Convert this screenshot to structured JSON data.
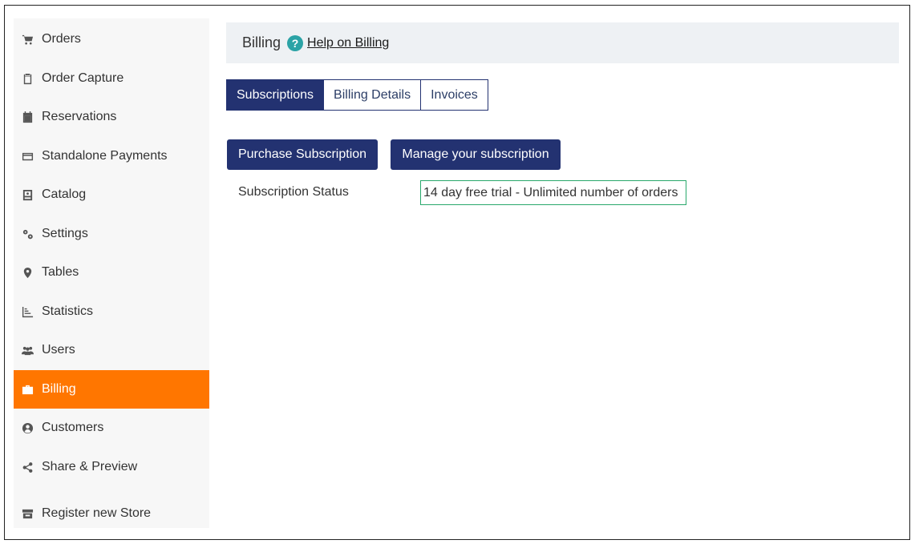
{
  "sidebar": {
    "items": [
      {
        "label": "Orders",
        "icon": "cart-icon"
      },
      {
        "label": "Order Capture",
        "icon": "clipboard-icon"
      },
      {
        "label": "Reservations",
        "icon": "calendar-icon"
      },
      {
        "label": "Standalone Payments",
        "icon": "credit-card-icon"
      },
      {
        "label": "Catalog",
        "icon": "catalog-book-icon"
      },
      {
        "label": "Settings",
        "icon": "gears-icon"
      },
      {
        "label": "Tables",
        "icon": "map-pin-icon"
      },
      {
        "label": "Statistics",
        "icon": "bar-chart-icon"
      },
      {
        "label": "Users",
        "icon": "users-icon"
      },
      {
        "label": "Billing",
        "icon": "briefcase-icon",
        "active": true
      },
      {
        "label": "Customers",
        "icon": "user-circle-icon"
      },
      {
        "label": "Share & Preview",
        "icon": "share-icon"
      },
      {
        "label": "Register new Store",
        "icon": "store-icon"
      }
    ]
  },
  "header": {
    "title": "Billing",
    "help_icon": "?",
    "help_link": "Help on Billing"
  },
  "tabs": [
    {
      "label": "Subscriptions",
      "active": true
    },
    {
      "label": "Billing Details",
      "active": false
    },
    {
      "label": "Invoices",
      "active": false
    }
  ],
  "actions": {
    "purchase_label": "Purchase Subscription",
    "manage_label": "Manage your subscription"
  },
  "subscription": {
    "status_label": "Subscription Status",
    "status_value": "14 day free trial - Unlimited number of orders"
  },
  "colors": {
    "accent_active": "#ff7600",
    "primary": "#233271",
    "help_icon": "#2ba3a6",
    "status_border": "#28a86b"
  }
}
